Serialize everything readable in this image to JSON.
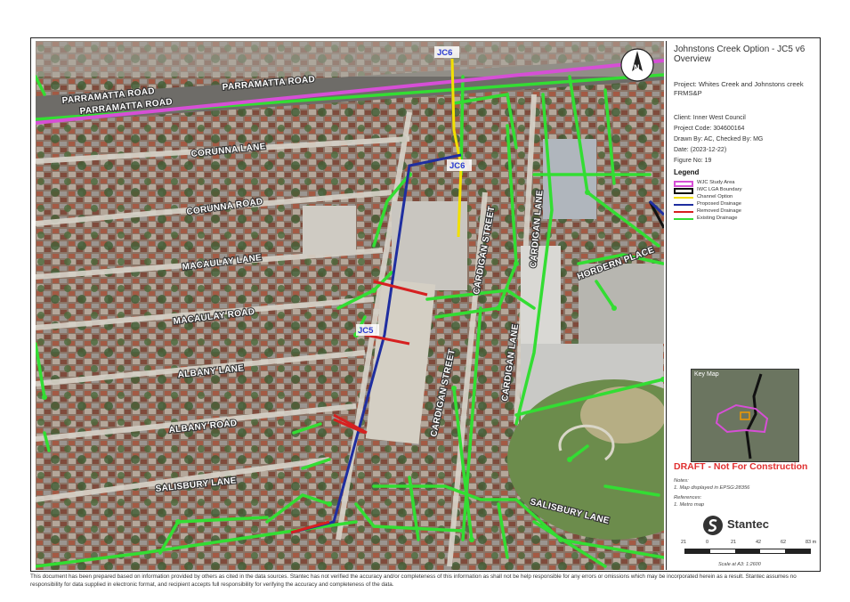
{
  "title_block": {
    "title": "Johnstons Creek Option - JC5 v6 Overview",
    "project_label": "Project:",
    "project": "Whites Creek and Johnstons creek FRMS&P",
    "client": "Client:  Inner West Council",
    "project_code": "Project Code:  304600164",
    "drawn_by": "Drawn By: AC, Checked By: MG",
    "date": "Date:  (2023-12-22)",
    "figure_no": "Figure No:  19"
  },
  "legend": {
    "title": "Legend",
    "items": [
      {
        "label": "WJC Study Area",
        "color": "#d64fd6",
        "kind": "outline"
      },
      {
        "label": "IWC LGA Boundary",
        "color": "#111111",
        "kind": "outline"
      },
      {
        "label": "Channel Option",
        "color": "#f2e000",
        "kind": "line"
      },
      {
        "label": "Proposed Drainage",
        "color": "#1f2ea0",
        "kind": "line"
      },
      {
        "label": "Removed Drainage",
        "color": "#d62020",
        "kind": "line"
      },
      {
        "label": "Existing Drainage",
        "color": "#33dd33",
        "kind": "line"
      }
    ]
  },
  "key_map": {
    "label": "Key Map"
  },
  "draft_notice": "DRAFT - Not For Construction",
  "notes": {
    "heading": "Notes:",
    "text": "1. Map displayed in EPSG:28356"
  },
  "references": {
    "heading": "References:",
    "text": "1. Metro map"
  },
  "brand": {
    "name": "Stantec"
  },
  "scale": {
    "ticks": [
      "21",
      "0",
      "21",
      "42",
      "62",
      "83 m"
    ],
    "caption": "Scale at A3: 1:2600"
  },
  "north_arrow": {
    "letter": "N"
  },
  "map_labels": {
    "roads": [
      {
        "key": "parramatta_1",
        "text": "PARRAMATTA ROAD"
      },
      {
        "key": "parramatta_2",
        "text": "PARRAMATTA ROAD"
      },
      {
        "key": "parramatta_3",
        "text": "PARRAMATTA ROAD"
      },
      {
        "key": "corunna_lane",
        "text": "CORUNNA LANE"
      },
      {
        "key": "corunna_road",
        "text": "CORUNNA ROAD"
      },
      {
        "key": "macaulay_lane",
        "text": "MACAULAY LANE"
      },
      {
        "key": "macaulay_road",
        "text": "MACAULAY ROAD"
      },
      {
        "key": "albany_lane",
        "text": "ALBANY LANE"
      },
      {
        "key": "albany_road",
        "text": "ALBANY ROAD"
      },
      {
        "key": "salisbury_lane_w",
        "text": "SALISBURY LANE"
      },
      {
        "key": "salisbury_lane_e",
        "text": "SALISBURY LANE"
      },
      {
        "key": "cardigan_street_n",
        "text": "CARDIGAN STREET"
      },
      {
        "key": "cardigan_street_s",
        "text": "CARDIGAN STREET"
      },
      {
        "key": "cardigan_lane_n",
        "text": "CARDIGAN LANE"
      },
      {
        "key": "cardigan_lane_s",
        "text": "CARDIGAN LANE"
      },
      {
        "key": "hordern_place",
        "text": "HORDERN PLACE"
      }
    ],
    "options": [
      {
        "key": "jc6_top",
        "text": "JC6"
      },
      {
        "key": "jc6_mid",
        "text": "JC6"
      },
      {
        "key": "jc5",
        "text": "JC5"
      }
    ]
  },
  "disclaimer": "This document has been prepared based on information provided by others as cited in the data sources. Stantec has not verified the accuracy and/or completeness of this information as shall not be help responsible for any errors or omissions which may be incorporated herein as a result. Stantec assumes no responsibility for data supplied in electronic format, and recipient accepts full responsibility for verifying the accuracy and completeness of the data."
}
